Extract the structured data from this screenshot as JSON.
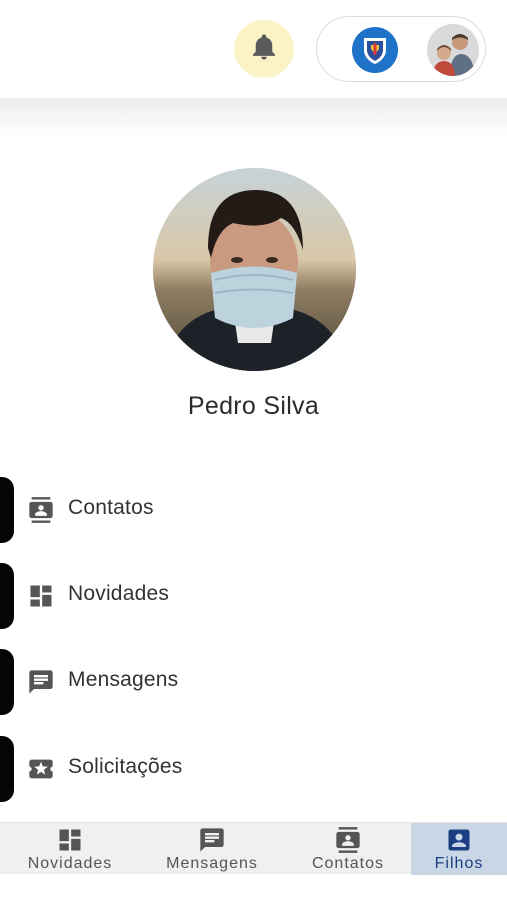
{
  "header": {
    "notification_icon": "bell-icon",
    "school_logo_icon": "school-shield-icon",
    "account_avatar": "parent-avatar"
  },
  "profile": {
    "name": "Pedro Silva",
    "photo": "student-photo"
  },
  "menu": {
    "items": [
      {
        "label": "Contatos",
        "icon": "contact-card-icon"
      },
      {
        "label": "Novidades",
        "icon": "dashboard-icon"
      },
      {
        "label": "Mensagens",
        "icon": "message-icon"
      },
      {
        "label": "Solicitações",
        "icon": "star-ticket-icon"
      }
    ]
  },
  "bottom_nav": {
    "items": [
      {
        "label": "Novidades",
        "icon": "dashboard-icon",
        "active": false
      },
      {
        "label": "Mensagens",
        "icon": "message-icon",
        "active": false
      },
      {
        "label": "Contatos",
        "icon": "contact-card-icon",
        "active": false
      },
      {
        "label": "Filhos",
        "icon": "person-badge-icon",
        "active": true
      }
    ]
  },
  "colors": {
    "accent": "#1b3d82",
    "active_tab_bg": "#c9d6e6",
    "bell_bg": "#fbf2c6",
    "school_blue": "#1e73c9",
    "menu_tab": "#050505"
  }
}
